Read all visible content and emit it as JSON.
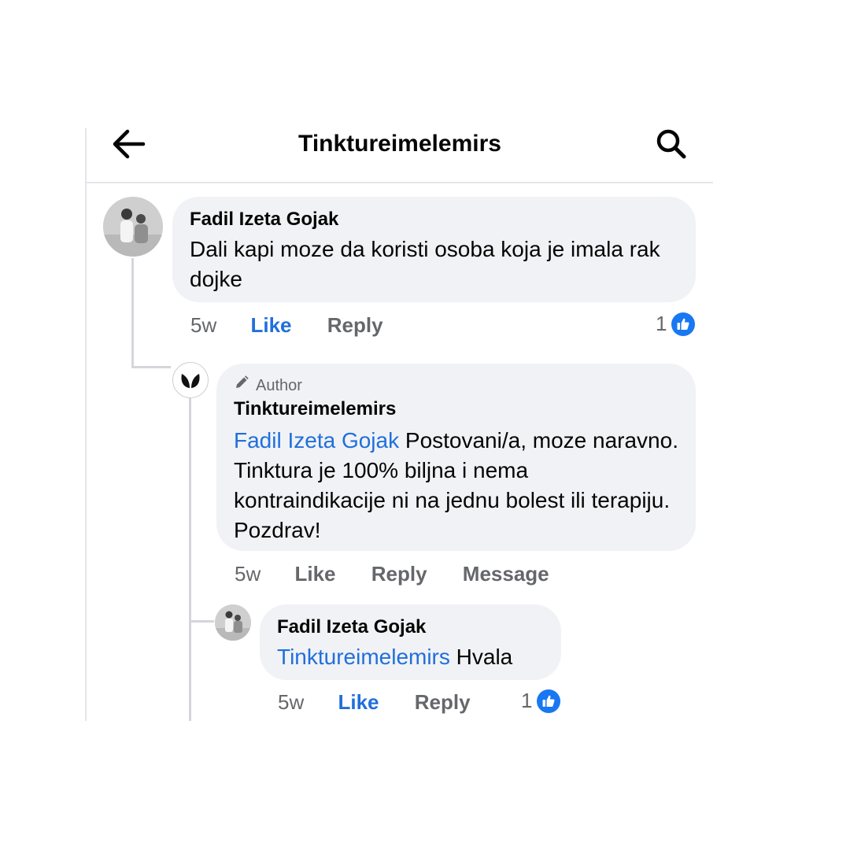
{
  "header": {
    "title": "Tinktureimelemirs",
    "back_icon": "arrow-left-icon",
    "search_icon": "search-icon"
  },
  "colors": {
    "bubble": "#f0f2f5",
    "accent": "#216fdb",
    "like_badge": "#1877f2",
    "meta_text": "#65676b"
  },
  "comments": [
    {
      "author": "Fadil Izeta Gojak",
      "text": "Dali kapi moze da koristi osoba koja je imala rak dojke",
      "time": "5w",
      "like_label": "Like",
      "reply_label": "Reply",
      "reaction_count": "1"
    },
    {
      "badge": "Author",
      "author": "Tinktureimelemirs",
      "mention": "Fadil Izeta Gojak",
      "text": " Postovani/a, moze naravno. Tinktura je 100% biljna i nema kontraindikacije ni na jednu bolest ili terapiju. Pozdrav!",
      "time": "5w",
      "like_label": "Like",
      "reply_label": "Reply",
      "message_label": "Message"
    },
    {
      "author": "Fadil Izeta Gojak",
      "mention": "Tinktureimelemirs",
      "text": " Hvala",
      "time": "5w",
      "like_label": "Like",
      "reply_label": "Reply",
      "reaction_count": "1"
    }
  ]
}
